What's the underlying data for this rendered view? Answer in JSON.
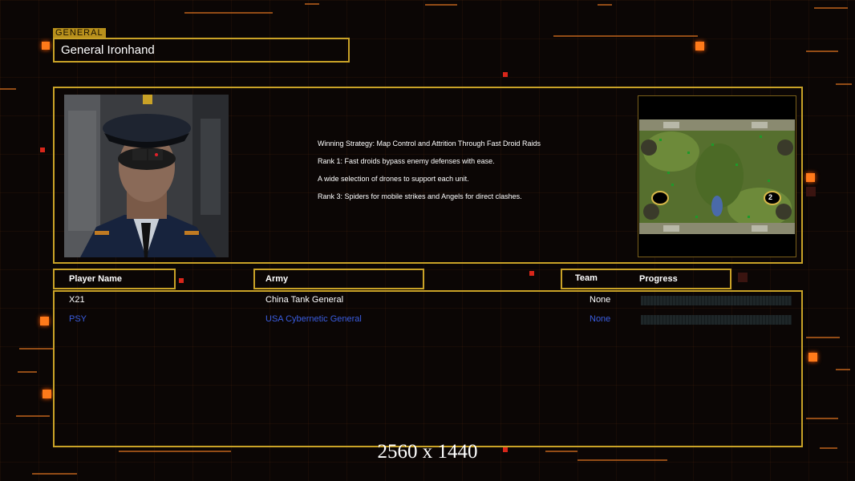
{
  "general": {
    "tag": "GENERAL",
    "name": "General Ironhand"
  },
  "strategy": {
    "lines": [
      "Winning Strategy: Map Control and Attrition Through Fast Droid Raids",
      "Rank 1: Fast droids bypass enemy defenses with ease.",
      "A wide selection of drones to support each unit.",
      "Rank 3: Spiders for mobile strikes and Angels for direct clashes."
    ]
  },
  "map": {
    "spawn_marker": "2"
  },
  "table": {
    "headers": {
      "player_name": "Player Name",
      "army": "Army",
      "team": "Team",
      "progress": "Progress"
    },
    "rows": [
      {
        "player": "X21",
        "army": "China Tank General",
        "team": "None",
        "color": "#ffffff",
        "progress": 0
      },
      {
        "player": "PSY",
        "army": "USA Cybernetic General",
        "team": "None",
        "color": "#3a5de0",
        "progress": 0
      }
    ]
  },
  "footer": {
    "resolution": "2560 x 1440"
  },
  "colors": {
    "frame": "#c9a227",
    "accent": "#ff7a1a",
    "player2": "#3a5de0"
  }
}
